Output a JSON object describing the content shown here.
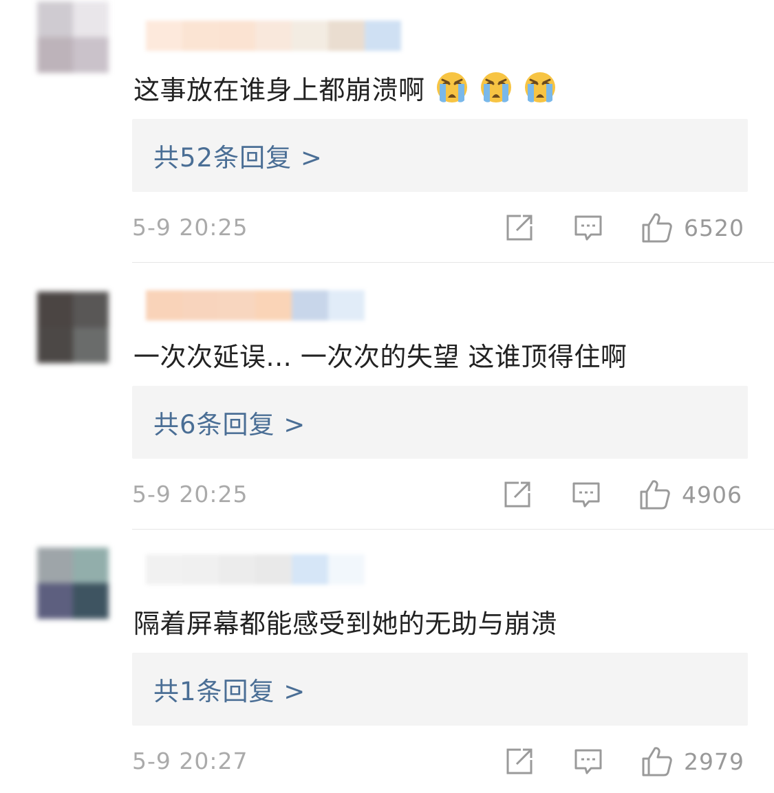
{
  "comments": [
    {
      "text": "这事放在谁身上都崩溃啊",
      "emojis": [
        "crying-face-icon",
        "crying-face-icon",
        "crying-face-icon"
      ],
      "replies_label": "共52条回复 >",
      "time": "5-9 20:25",
      "likes": "6520"
    },
    {
      "text": "一次次延误... 一次次的失望 这谁顶得住啊",
      "replies_label": "共6条回复 >",
      "time": "5-9 20:25",
      "likes": "4906"
    },
    {
      "text": "隔着屏幕都能感受到她的无助与崩溃",
      "replies_label": "共1条回复 >",
      "time": "5-9 20:27",
      "likes": "2979"
    }
  ],
  "colors": {
    "reply_link": "#4a6e95",
    "reply_bg": "#f4f4f4",
    "meta_text": "#999999",
    "icon_stroke": "#9a9a9a"
  }
}
